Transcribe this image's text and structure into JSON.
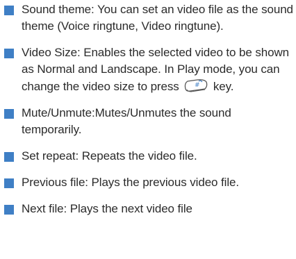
{
  "colors": {
    "bullet": "#3f7fc5",
    "text": "#2b2b2b"
  },
  "items": [
    {
      "text": "Sound theme: You can set an video file as the sound theme (Voice ringtune, Video ringtune)."
    },
    {
      "text_before_icon": "Video Size: Enables the selected video to be shown as Normal and Landscape. In Play mode, you can change the video size to press",
      "icon": "hash-key-icon",
      "text_after_icon": "key."
    },
    {
      "text": "Mute/Unmute:Mutes/Unmutes the sound temporarily."
    },
    {
      "text": "Set repeat: Repeats the video file."
    },
    {
      "text": "Previous file: Plays the previous video file."
    },
    {
      "text": "Next file: Plays the next video file"
    }
  ]
}
